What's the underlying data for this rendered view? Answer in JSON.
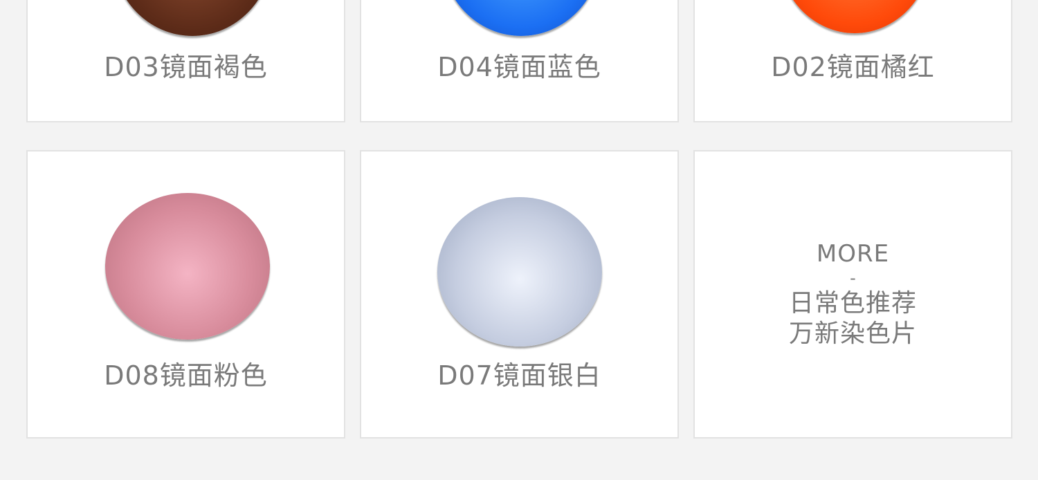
{
  "lenses": [
    {
      "code_label": "D03镜面褐色",
      "color": "#5a2a18"
    },
    {
      "code_label": "D04镜面蓝色",
      "color": "#1a6ff0"
    },
    {
      "code_label": "D02镜面橘红",
      "color": "#ff4a0a"
    },
    {
      "code_label": "D08镜面粉色",
      "color": "#d48a98"
    },
    {
      "code_label": "D07镜面银白",
      "color": "#b8c2d8"
    }
  ],
  "more": {
    "title": "MORE",
    "dash": "-",
    "line1": "日常色推荐",
    "line2": "万新染色片"
  }
}
